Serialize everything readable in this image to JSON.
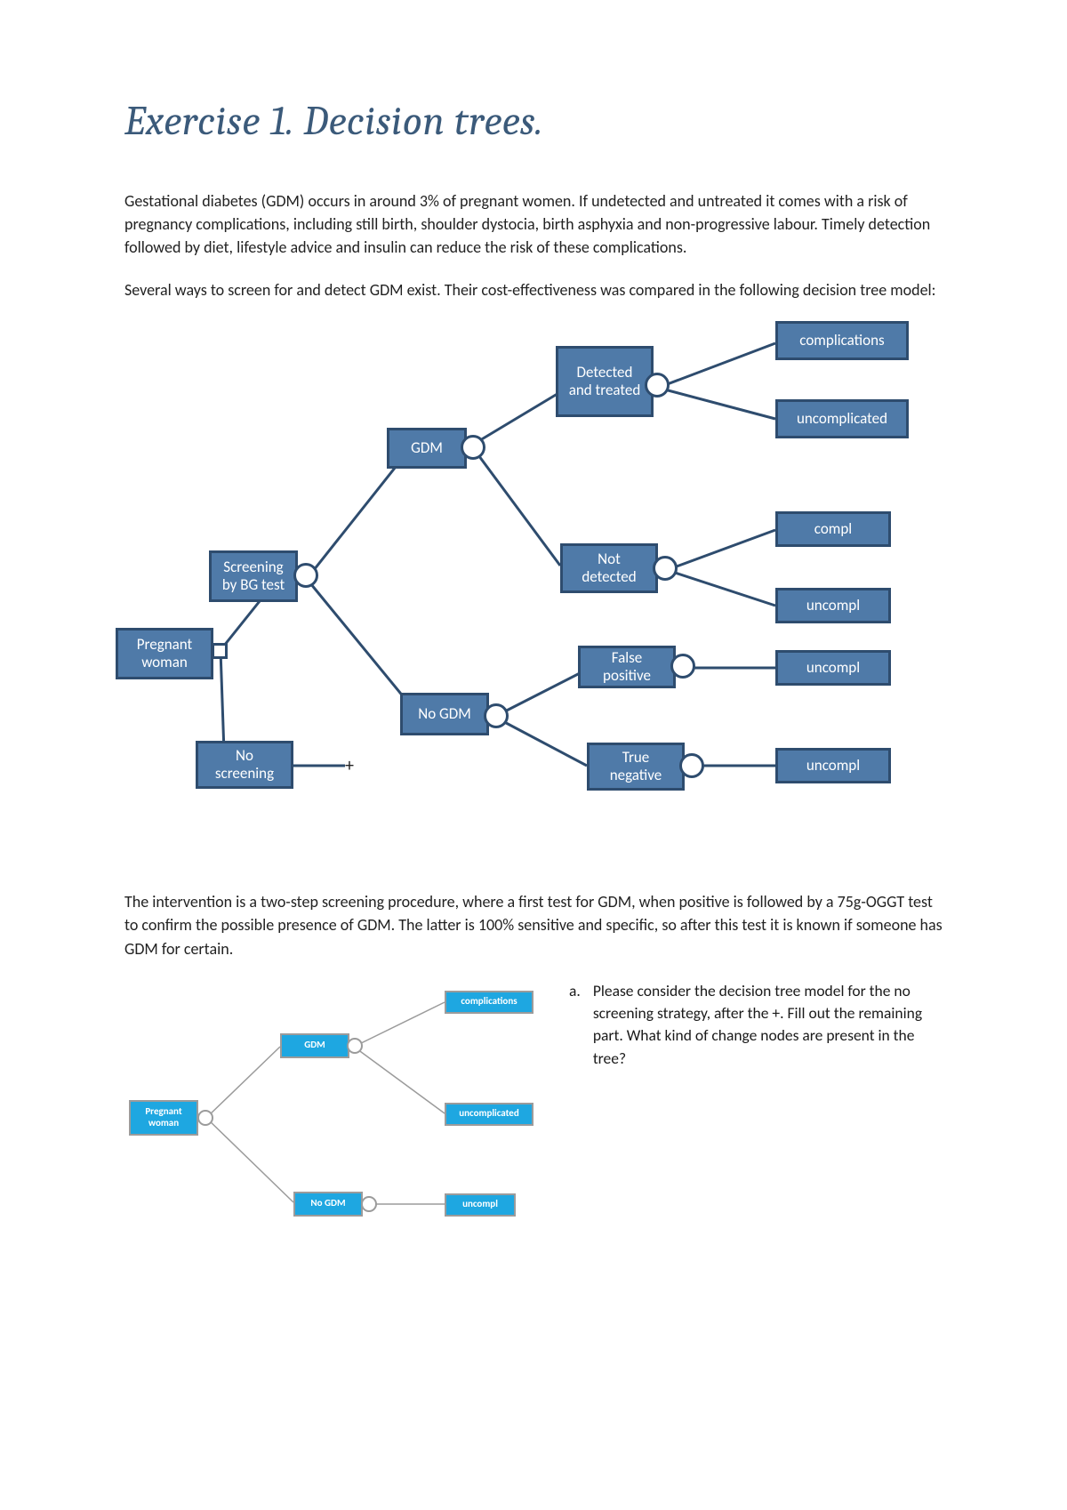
{
  "title": "Exercise 1. Decision trees.",
  "para1": "Gestational diabetes (GDM) occurs in around 3% of pregnant women. If undetected and untreated it comes with a risk of pregnancy complications, including still birth, shoulder dystocia, birth asphyxia and non-progressive labour. Timely detection followed by diet, lifestyle advice and insulin can reduce the risk of these complications.",
  "para2": "Several ways to screen for and detect GDM exist. Their cost-effectiveness was compared in the following decision tree model:",
  "tree1": {
    "root": "Pregnant woman",
    "screening": "Screening by BG test",
    "noscreening": "No screening",
    "gdm": "GDM",
    "nogdm": "No GDM",
    "detected": "Detected and treated",
    "notdetected": "Not detected",
    "falsepos": "False positive",
    "trueneg": "True negative",
    "complications": "complications",
    "uncomplicated": "uncomplicated",
    "compl": "compl",
    "uncompl1": "uncompl",
    "uncompl2": "uncompl",
    "uncompl3": "uncompl",
    "plus": "+"
  },
  "para3": "The intervention is a two-step screening procedure, where a first test for GDM, when positive is followed by a 75g-OGGT test to confirm the possible presence of GDM. The latter is 100% sensitive and specific, so after this test it is known if someone has GDM for certain.",
  "tree2": {
    "root": "Pregnant woman",
    "gdm": "GDM",
    "nogdm": "No GDM",
    "complications": "complications",
    "uncomplicated": "uncomplicated",
    "uncompl": "uncompl"
  },
  "question": {
    "letter": "a.",
    "text": "Please consider the decision tree model for the no screening strategy, after the +. Fill out the remaining part. What kind of change nodes are present in the tree?"
  }
}
